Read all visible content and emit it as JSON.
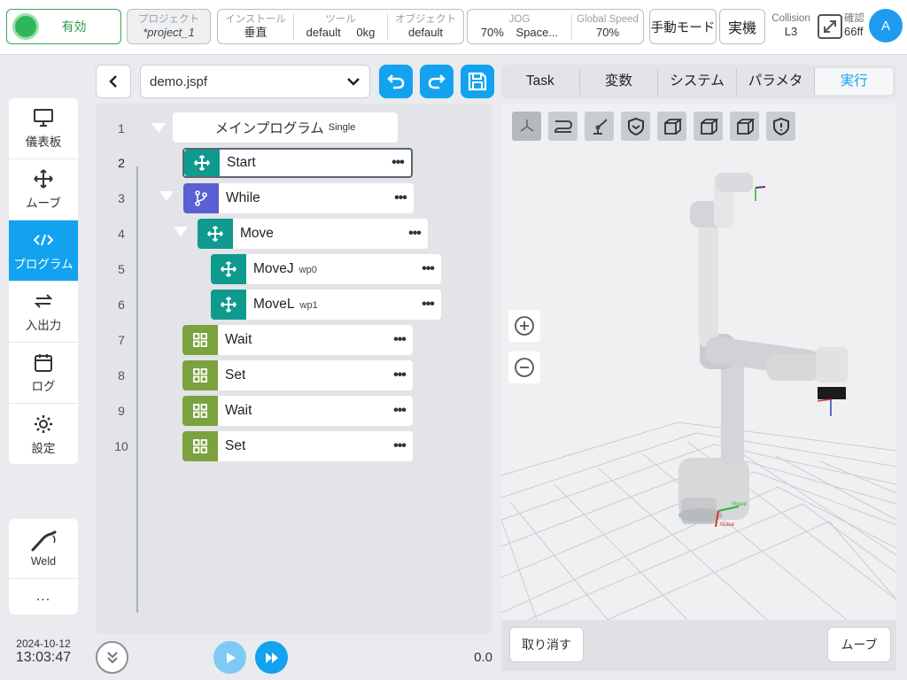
{
  "topbar": {
    "enable_label": "有効",
    "project": {
      "label": "プロジェクト",
      "value": "*project_1"
    },
    "install": {
      "label": "インストール",
      "value": "垂直"
    },
    "tool": {
      "label": "ツール",
      "value_name": "default",
      "value_load": "0kg"
    },
    "object": {
      "label": "オブジェクト",
      "value": "default"
    },
    "jog": {
      "label": "JOG",
      "value_pct": "70%",
      "value_mode": "Space..."
    },
    "global_speed": {
      "label": "Global Speed",
      "value": "70%"
    },
    "manual_mode": "手動モード",
    "real_machine": "実機",
    "collision": {
      "label": "Collision",
      "value": "L3"
    },
    "confirm": {
      "label": "確認",
      "value": "66ff"
    },
    "avatar": "A"
  },
  "nav": {
    "items": [
      {
        "label": "儀表板",
        "icon": "monitor-icon"
      },
      {
        "label": "ムーブ",
        "icon": "move-arrows-icon"
      },
      {
        "label": "プログラム",
        "icon": "code-icon",
        "active": true
      },
      {
        "label": "入出力",
        "icon": "swap-arrows-icon"
      },
      {
        "label": "ログ",
        "icon": "calendar-icon"
      },
      {
        "label": "設定",
        "icon": "gear-icon"
      }
    ],
    "weld": {
      "label": "Weld",
      "icon": "weld-torch-icon"
    },
    "more": "..."
  },
  "clock": {
    "date": "2024-10-12",
    "time": "13:03:47"
  },
  "editor": {
    "file_name": "demo.jspf",
    "main_program": {
      "label": "メインプログラム",
      "mode": "Single"
    },
    "lines": [
      "1",
      "2",
      "3",
      "4",
      "5",
      "6",
      "7",
      "8",
      "9",
      "10"
    ],
    "nodes": [
      {
        "label": "Start",
        "sub": ""
      },
      {
        "label": "While",
        "sub": ""
      },
      {
        "label": "Move",
        "sub": ""
      },
      {
        "label": "MoveJ",
        "sub": "wp0"
      },
      {
        "label": "MoveL",
        "sub": "wp1"
      },
      {
        "label": "Wait",
        "sub": ""
      },
      {
        "label": "Set",
        "sub": ""
      },
      {
        "label": "Wait",
        "sub": ""
      },
      {
        "label": "Set",
        "sub": ""
      }
    ],
    "speed_value": "0.0"
  },
  "tabs": [
    "Task",
    "変数",
    "システム",
    "パラメタ",
    "実行"
  ],
  "viewport": {
    "axis_labels": {
      "x": "Xbase",
      "y": "Ybase"
    },
    "undo_label": "取り消す",
    "move_label": "ムーブ"
  },
  "colors": {
    "accent": "#12a2ef",
    "move_teal": "#0f9a8e",
    "while_purple": "#5a5fd4",
    "io_green": "#7ba23f",
    "enable_green": "#2fb55a"
  }
}
